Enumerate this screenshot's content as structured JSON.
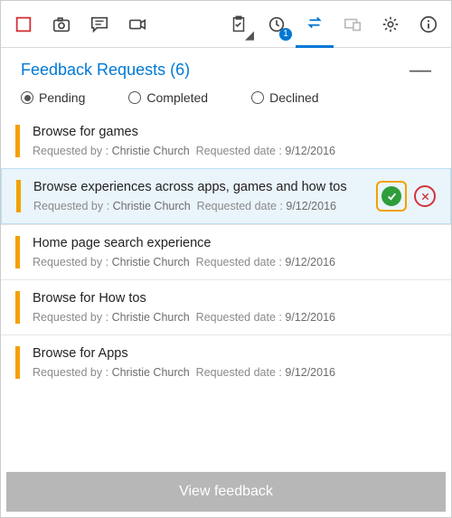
{
  "toolbar": {
    "badge_count": "1"
  },
  "panel": {
    "title": "Feedback Requests (6)"
  },
  "filters": {
    "pending": "Pending",
    "completed": "Completed",
    "declined": "Declined",
    "selected": "pending"
  },
  "meta_labels": {
    "requested_by": "Requested by :",
    "requested_date": "Requested date :"
  },
  "items": [
    {
      "title": "Browse for games",
      "requester": "Christie Church",
      "date": "9/12/2016",
      "selected": false
    },
    {
      "title": "Browse experiences across apps, games and how tos",
      "requester": "Christie Church",
      "date": "9/12/2016",
      "selected": true
    },
    {
      "title": "Home page search experience",
      "requester": "Christie Church",
      "date": "9/12/2016",
      "selected": false
    },
    {
      "title": "Browse for How tos",
      "requester": "Christie Church",
      "date": "9/12/2016",
      "selected": false
    },
    {
      "title": "Browse for Apps",
      "requester": "Christie Church",
      "date": "9/12/2016",
      "selected": false
    }
  ],
  "footer": {
    "view_feedback": "View feedback"
  }
}
